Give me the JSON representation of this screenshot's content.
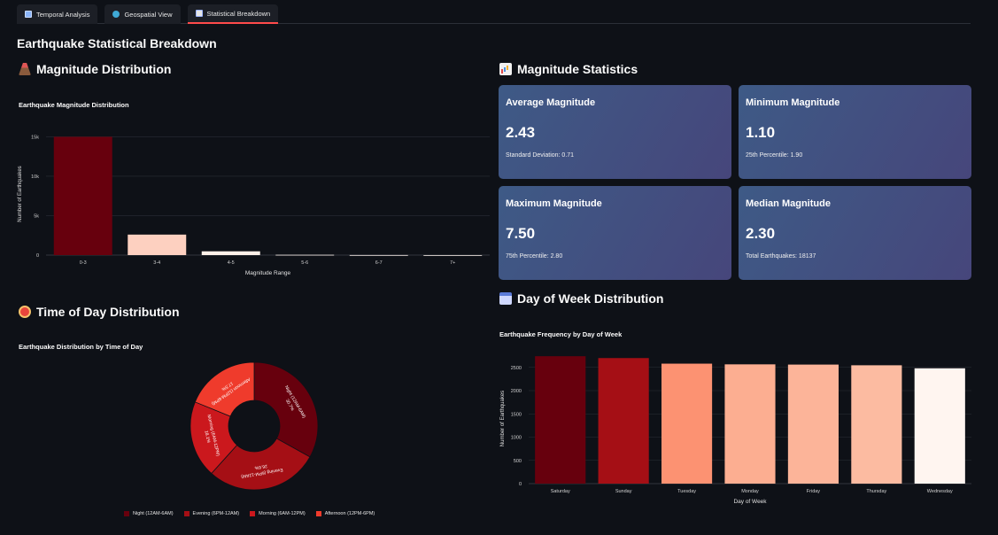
{
  "tabs": [
    {
      "label": "Temporal Analysis",
      "icon": "chart-icon"
    },
    {
      "label": "Geospatial View",
      "icon": "globe-icon"
    },
    {
      "label": "Statistical Breakdown",
      "icon": "stats-icon",
      "active": true
    }
  ],
  "page_title": "Earthquake Statistical Breakdown",
  "sections": {
    "magnitude_distribution": "Magnitude Distribution",
    "magnitude_statistics": "Magnitude Statistics",
    "time_of_day": "Time of Day Distribution",
    "day_of_week": "Day of Week Distribution"
  },
  "cards": [
    {
      "title": "Average Magnitude",
      "value": "2.43",
      "sub": "Standard Deviation: 0.71"
    },
    {
      "title": "Minimum Magnitude",
      "value": "1.10",
      "sub": "25th Percentile: 1.90"
    },
    {
      "title": "Maximum Magnitude",
      "value": "7.50",
      "sub": "75th Percentile: 2.80"
    },
    {
      "title": "Median Magnitude",
      "value": "2.30",
      "sub": "Total Earthquakes: 18137"
    }
  ],
  "colors": {
    "accent": "#ff4b4b",
    "background": "#0e1117"
  },
  "chart_data": [
    {
      "id": "magnitude",
      "type": "bar",
      "title": "Earthquake Magnitude Distribution",
      "xlabel": "Magnitude Range",
      "ylabel": "Number of Earthquakes",
      "categories": [
        "0-3",
        "3-4",
        "4-5",
        "5-6",
        "6-7",
        "7+"
      ],
      "values": [
        15000,
        2600,
        480,
        40,
        10,
        2
      ],
      "colors": [
        "#67000d",
        "#fdd0c0",
        "#fff0e8",
        "#fff5f0",
        "#fff5f0",
        "#fff5f0"
      ],
      "ylim": [
        0,
        15500
      ],
      "yticks": [
        0,
        5000,
        10000,
        15000
      ],
      "ytick_labels": [
        "0",
        "5k",
        "10k",
        "15k"
      ],
      "grid": true
    },
    {
      "id": "time_of_day",
      "type": "pie",
      "title": "Earthquake Distribution by Time of Day",
      "categories": [
        "Night (12AM-6AM)",
        "Evening (6PM-12AM)",
        "Morning (6AM-12PM)",
        "Afternoon (12PM-6PM)"
      ],
      "values": [
        30.7,
        26.6,
        18.1,
        17.5
      ],
      "slice_labels": [
        [
          "Night (12AM-6AM)",
          "30.7%"
        ],
        [
          "Evening (6PM-12AM)",
          "26.6%"
        ],
        [
          "Morning (6AM-12PM)",
          "18.1%"
        ],
        [
          "Afternoon (12PM-6PM)",
          "17.5%"
        ]
      ],
      "colors": [
        "#67000d",
        "#a50f15",
        "#cb181d",
        "#ef3b2c"
      ],
      "legend": "bottom"
    },
    {
      "id": "day_of_week",
      "type": "bar",
      "title": "Earthquake Frequency by Day of Week",
      "xlabel": "Day of Week",
      "ylabel": "Number of Earthquakes",
      "categories": [
        "Saturday",
        "Sunday",
        "Tuesday",
        "Monday",
        "Friday",
        "Thursday",
        "Wednesday"
      ],
      "values": [
        2740,
        2700,
        2580,
        2565,
        2560,
        2545,
        2480
      ],
      "colors": [
        "#67000d",
        "#a50f15",
        "#fc9272",
        "#fcae91",
        "#fcb499",
        "#fcbba1",
        "#fff5f0"
      ],
      "ylim": [
        0,
        2800
      ],
      "yticks": [
        0,
        500,
        1000,
        1500,
        2000,
        2500
      ],
      "ytick_labels": [
        "0",
        "500",
        "1000",
        "1500",
        "2000",
        "2500"
      ],
      "grid": true
    }
  ]
}
